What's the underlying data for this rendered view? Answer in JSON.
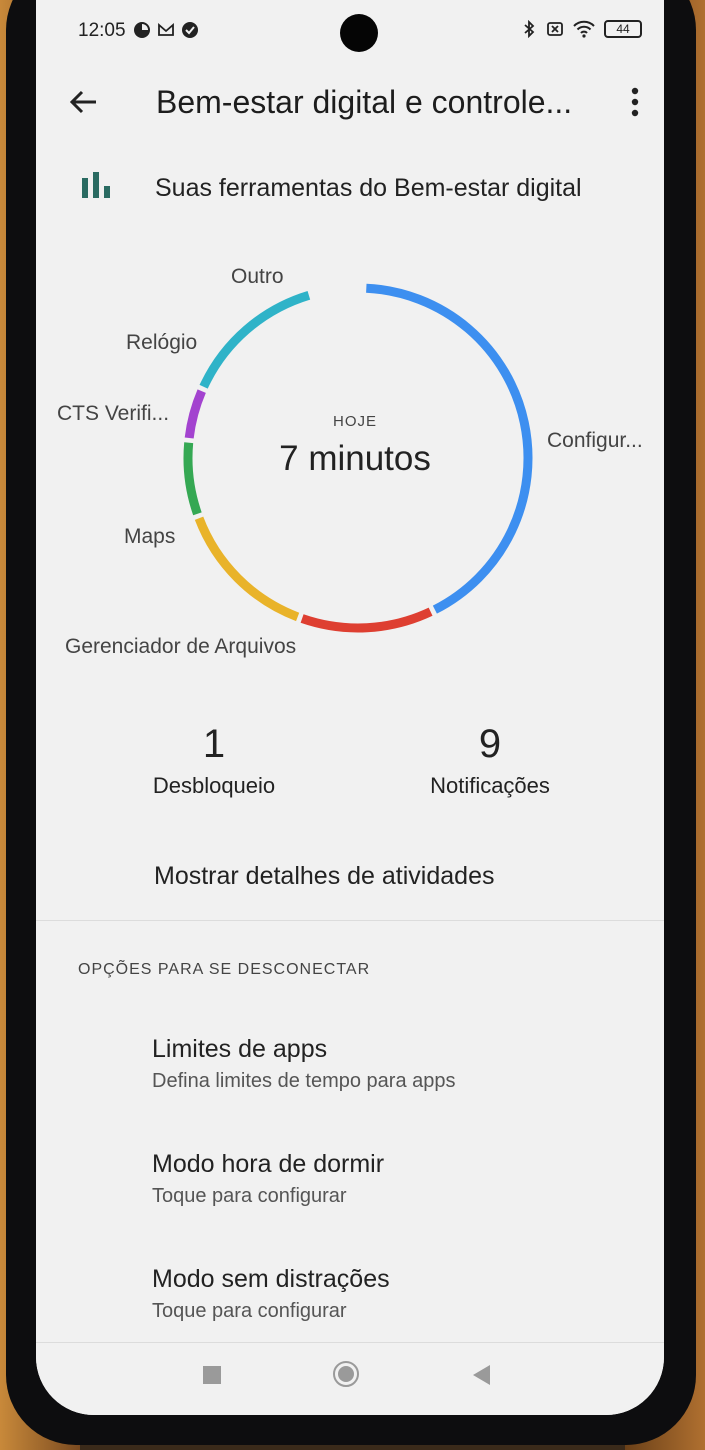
{
  "status_bar": {
    "time": "12:05",
    "battery": "44",
    "icons": [
      "data-saver-icon",
      "gmail-icon",
      "check-circle-icon",
      "bluetooth-icon",
      "no-sim-icon",
      "wifi-icon",
      "battery-icon"
    ]
  },
  "app_bar": {
    "title": "Bem-estar digital e controle...",
    "back_icon": "arrow-back-icon",
    "menu_icon": "more-vert-icon"
  },
  "tools": {
    "label": "Suas ferramentas do Bem-estar digital",
    "icon": "bar-chart-icon"
  },
  "usage_chart": {
    "caption": "HOJE",
    "total": "7 minutos",
    "segments": [
      {
        "label": "Configur...",
        "color": "#3d8ff0",
        "fraction": 0.422
      },
      {
        "label": "Gerenciador de Arquivos",
        "color": "#de3f31",
        "fraction": 0.128
      },
      {
        "label": "Maps",
        "color": "#e9b32a",
        "fraction": 0.139
      },
      {
        "label": "CTS Verifi...",
        "color": "#35a853",
        "fraction": 0.072
      },
      {
        "label": "Relógio",
        "color": "#a343cf",
        "fraction": 0.05
      },
      {
        "label": "Outro",
        "color": "#2fb3c8",
        "fraction": 0.139
      }
    ]
  },
  "stats": {
    "unlocks": {
      "value": "1",
      "label": "Desbloqueio"
    },
    "notifications": {
      "value": "9",
      "label": "Notificações"
    }
  },
  "show_details": "Mostrar detalhes de atividades",
  "section_header": "OPÇÕES PARA SE DESCONECTAR",
  "options": [
    {
      "title": "Limites de apps",
      "subtitle": "Defina limites de tempo para apps"
    },
    {
      "title": "Modo hora de dormir",
      "subtitle": "Toque para configurar"
    },
    {
      "title": "Modo sem distrações",
      "subtitle": "Toque para configurar"
    }
  ],
  "nav_bar": {
    "icons": [
      "recents-icon",
      "home-icon",
      "back-nav-icon"
    ]
  }
}
